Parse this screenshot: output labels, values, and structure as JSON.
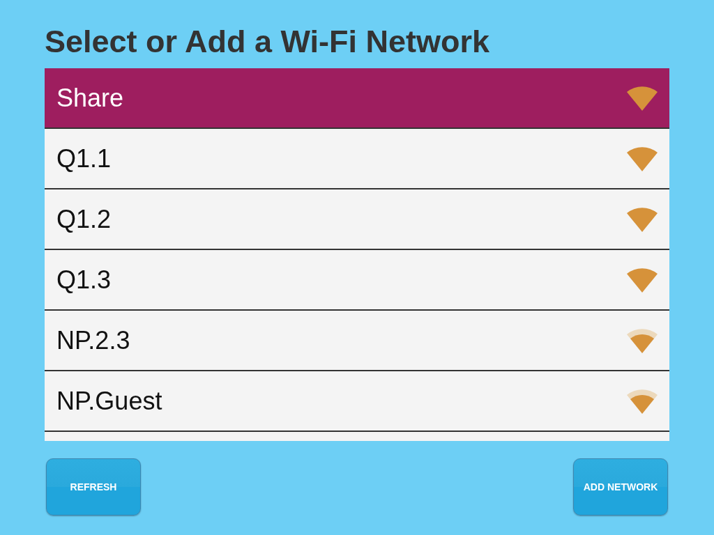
{
  "title": "Select or Add a Wi-Fi Network",
  "networks": [
    {
      "name": "Share",
      "selected": true,
      "kind": "strong"
    },
    {
      "name": "Q1.1",
      "selected": false,
      "kind": "strong"
    },
    {
      "name": "Q1.2",
      "selected": false,
      "kind": "strong"
    },
    {
      "name": "Q1.3",
      "selected": false,
      "kind": "strong"
    },
    {
      "name": "NP.2.3",
      "selected": false,
      "kind": "weak"
    },
    {
      "name": "NP.Guest",
      "selected": false,
      "kind": "weak"
    }
  ],
  "buttons": [
    "REFRESH",
    "ADD NETWORK"
  ]
}
